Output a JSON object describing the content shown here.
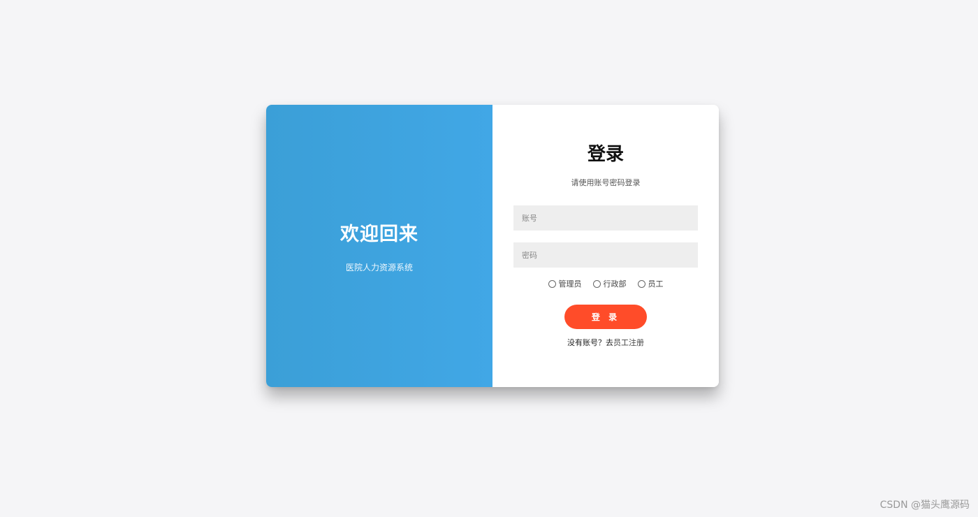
{
  "left_panel": {
    "title": "欢迎回来",
    "subtitle": "医院人力资源系统"
  },
  "login": {
    "title": "登录",
    "subtitle": "请使用账号密码登录",
    "account_placeholder": "账号",
    "password_placeholder": "密码",
    "roles": [
      "管理员",
      "行政部",
      "员工"
    ],
    "button_label": "登 录",
    "register_prompt": "没有账号？去",
    "register_link": "员工注册"
  },
  "watermark": "CSDN @猫头鹰源码",
  "colors": {
    "background": "#f5f5f7",
    "left_panel": "#3ea3e0",
    "button": "#ff4c29",
    "input_bg": "#eeeeee"
  }
}
